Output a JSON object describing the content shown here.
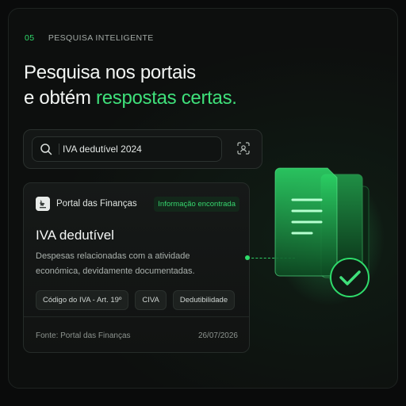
{
  "section": {
    "number": "05",
    "label": "PESQUISA INTELIGENTE"
  },
  "headline": {
    "line1": "Pesquisa nos portais",
    "line2_prefix": "e obtém ",
    "line2_highlight": "respostas certas."
  },
  "search": {
    "query": "IVA dedutível 2024"
  },
  "result": {
    "portal": "Portal das Finanças",
    "badge": "Informação encontrada",
    "title": "IVA dedutível",
    "description": "Despesas relacionadas com a atividade económica, devidamente documentadas.",
    "tags": [
      "Código do IVA - Art. 19º",
      "CIVA",
      "Dedutibilidade"
    ],
    "source": "Fonte: Portal das Finanças",
    "date": "26/07/2026"
  },
  "icons": {
    "search": "search-icon",
    "scan": "scan-icon",
    "portal": "portal-logo-icon",
    "docs": "document-folder-icon",
    "check": "check-icon"
  },
  "colors": {
    "accent": "#3fe07a",
    "background": "#0a0b0b",
    "card": "#161918"
  }
}
